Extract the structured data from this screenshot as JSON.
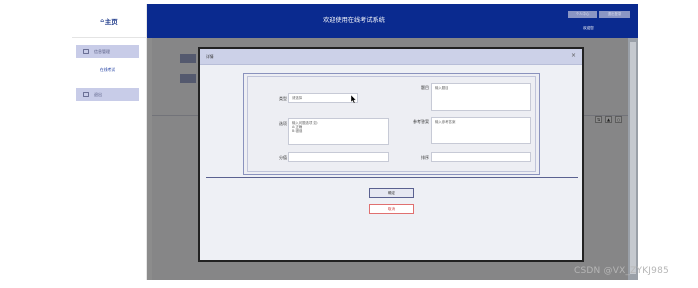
{
  "sidebar": {
    "home_icon": "⌂",
    "home_label": "主页",
    "items": [
      {
        "label": "信息管理",
        "icon": "folder-icon"
      },
      {
        "label": "退出",
        "icon": "logout-icon"
      }
    ],
    "sub_items": [
      {
        "label": "在线考试"
      }
    ]
  },
  "header": {
    "title": "欢迎使用在线考试系统",
    "buttons": [
      "个人中心",
      "退出登录"
    ],
    "user": "欢迎您"
  },
  "background": {
    "controls": [
      "⇅",
      "▲",
      "○"
    ]
  },
  "dialog": {
    "title": "详情",
    "close": "×",
    "fields": {
      "type": {
        "label": "类型",
        "value": "请选择",
        "chevron": "⌄"
      },
      "question": {
        "label": "题目",
        "placeholder": "输入题目"
      },
      "options": {
        "label": "选项",
        "value": "输入问题选项 如:\nA:正确\nB:错误"
      },
      "answer": {
        "label": "参考答案",
        "placeholder": "输入参考答案"
      },
      "score": {
        "label": "分值",
        "value": ""
      },
      "sort": {
        "label": "排序",
        "value": ""
      }
    },
    "ok_label": "确定",
    "cancel_label": "取消"
  },
  "watermark": "CSDN @VX_ZYKJ985",
  "colors": {
    "header_bg": "#0a2a8f",
    "menu_bg": "#c8cce8",
    "dialog_header_bg": "#ccd1e8",
    "cancel_red": "#d04848"
  }
}
